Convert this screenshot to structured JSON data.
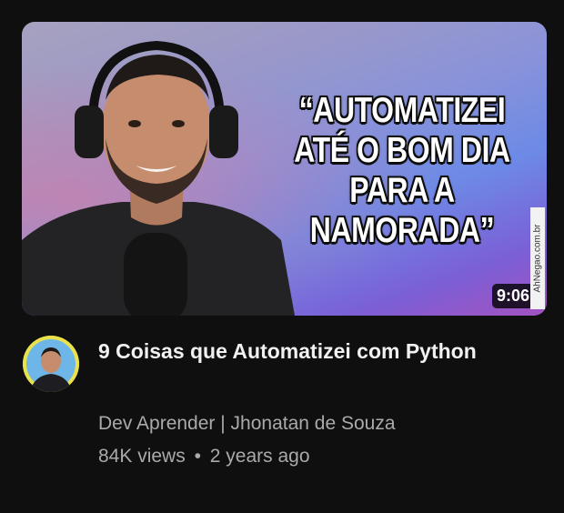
{
  "video": {
    "thumbnail_text": "“AUTOMATIZEI ATÉ O BOM DIA PARA A NAMORADA”",
    "duration": "9:06",
    "watermark": "AhNegao.com.br",
    "title": "9 Coisas que Automatizei com Python",
    "channel": "Dev Aprender | Jhonatan de Souza",
    "views": "84K views",
    "separator": "•",
    "age": "2 years ago"
  },
  "colors": {
    "background": "#0f0f0f",
    "title": "#f1f1f1",
    "secondary_text": "#aaaaaa",
    "avatar_ring": "#e9e24d"
  }
}
